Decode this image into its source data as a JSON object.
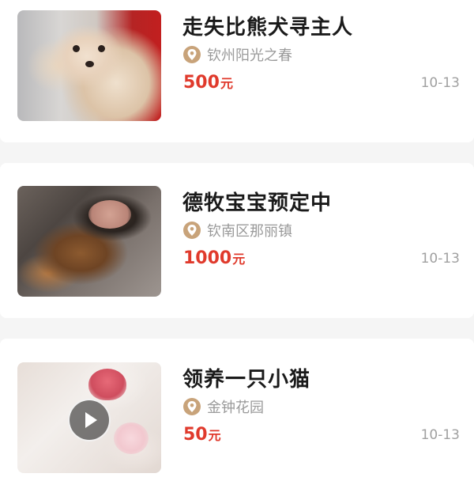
{
  "listings": [
    {
      "title": "走失比熊犬寻主人",
      "location": "钦州阳光之春",
      "price": "500",
      "price_unit": "元",
      "date": "10-13",
      "thumbnail": "bichon-dog-photo",
      "is_video": false
    },
    {
      "title": "德牧宝宝预定中",
      "location": "钦南区那丽镇",
      "price": "1000",
      "price_unit": "元",
      "date": "10-13",
      "thumbnail": "german-shepherd-puppies-photo",
      "is_video": false
    },
    {
      "title": "领养一只小猫",
      "location": "金钟花园",
      "price": "50",
      "price_unit": "元",
      "date": "10-13",
      "thumbnail": "white-kitten-photo",
      "is_video": true
    }
  ],
  "icons": {
    "location": "location-pin-icon",
    "play": "play-icon"
  },
  "colors": {
    "price": "#e03a2c",
    "location_icon": "#c8a37a",
    "muted_text": "#9a9a9a",
    "background": "#f5f5f5",
    "card": "#ffffff"
  }
}
